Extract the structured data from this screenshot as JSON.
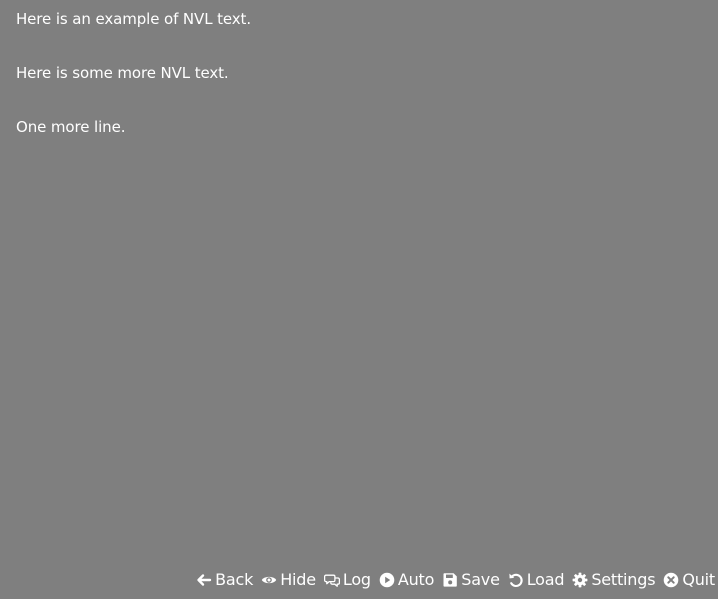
{
  "nvl": {
    "lines": [
      "Here is an example of NVL text.",
      "Here is some more NVL text.",
      "One more line."
    ]
  },
  "quick_menu": {
    "back": {
      "label": "Back",
      "icon": "arrow-left-icon"
    },
    "hide": {
      "label": "Hide",
      "icon": "eye-icon"
    },
    "log": {
      "label": "Log",
      "icon": "chat-bubbles-icon"
    },
    "auto": {
      "label": "Auto",
      "icon": "play-circle-icon"
    },
    "save": {
      "label": "Save",
      "icon": "floppy-disk-icon"
    },
    "load": {
      "label": "Load",
      "icon": "undo-icon"
    },
    "settings": {
      "label": "Settings",
      "icon": "gear-icon"
    },
    "quit": {
      "label": "Quit",
      "icon": "close-circle-icon"
    }
  },
  "colors": {
    "background": "#7f7f7f",
    "text": "#ffffff"
  }
}
